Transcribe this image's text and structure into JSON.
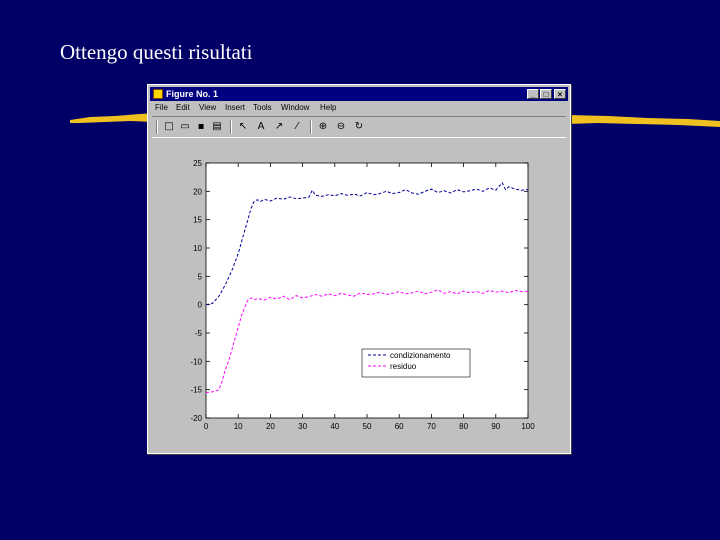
{
  "slide": {
    "title": "Ottengo questi risultati"
  },
  "window": {
    "title": "Figure No. 1",
    "buttons": {
      "minimize": "_",
      "maximize": "□",
      "close": "×"
    },
    "menu": [
      "File",
      "Edit",
      "View",
      "Insert",
      "Tools",
      "Window",
      "Help"
    ]
  },
  "toolbar": {
    "tools": [
      {
        "name": "new-file-icon",
        "glyph": "□"
      },
      {
        "name": "open-folder-icon",
        "glyph": "▭"
      },
      {
        "name": "save-icon",
        "glyph": "▪"
      },
      {
        "name": "print-icon",
        "glyph": "▤"
      },
      {
        "name": "select-arrow-icon",
        "glyph": "↖"
      },
      {
        "name": "text-tool-icon",
        "glyph": "A"
      },
      {
        "name": "arrow-tool-icon",
        "glyph": "↗"
      },
      {
        "name": "line-tool-icon",
        "glyph": "⁄"
      },
      {
        "name": "zoom-in-icon",
        "glyph": "⊕"
      },
      {
        "name": "zoom-out-icon",
        "glyph": "⊖"
      },
      {
        "name": "rotate-icon",
        "glyph": "↻"
      }
    ]
  },
  "colors": {
    "background": "#000066",
    "series1": "#000099",
    "series2": "#ff00ff",
    "brush": "#f0c020"
  },
  "chart_data": {
    "type": "line",
    "xlim": [
      0,
      100
    ],
    "ylim": [
      -20,
      25
    ],
    "xticks": [
      0,
      10,
      20,
      30,
      40,
      50,
      60,
      70,
      80,
      90,
      100
    ],
    "yticks": [
      -20,
      -15,
      -10,
      -5,
      0,
      5,
      10,
      15,
      20,
      25
    ],
    "xtick_labels": [
      "0",
      "10",
      "20",
      "30",
      "40",
      "50",
      "60",
      "70",
      "80",
      "90",
      "100"
    ],
    "ytick_labels": [
      "-20",
      "-15",
      "-10",
      "-5",
      "0",
      "5",
      "10",
      "15",
      "20",
      "25"
    ],
    "grid": false,
    "legend_placement": "lower-right",
    "series": [
      {
        "name": "condizionamento",
        "style": "dashed",
        "color": "#000099",
        "x": [
          0,
          2,
          4,
          6,
          8,
          10,
          11,
          12,
          13,
          14,
          15,
          16,
          17,
          18,
          20,
          22,
          24,
          26,
          28,
          30,
          32,
          33,
          34,
          36,
          38,
          40,
          42,
          44,
          46,
          48,
          50,
          52,
          54,
          56,
          58,
          60,
          62,
          64,
          66,
          68,
          70,
          72,
          74,
          76,
          78,
          80,
          82,
          84,
          86,
          88,
          90,
          92,
          93,
          94,
          96,
          98,
          100
        ],
        "y": [
          0,
          0.2,
          1.5,
          3.5,
          6,
          9,
          11,
          13,
          15,
          17,
          18.3,
          18.5,
          18.2,
          18.6,
          18.3,
          18.8,
          18.6,
          19.0,
          18.7,
          18.8,
          19.0,
          20.2,
          19.3,
          19.1,
          19.4,
          19.2,
          19.6,
          19.3,
          19.5,
          19.2,
          19.8,
          19.4,
          19.6,
          20.0,
          19.6,
          19.8,
          20.3,
          19.7,
          19.5,
          20.0,
          20.4,
          19.8,
          20.1,
          19.7,
          20.3,
          19.9,
          20.1,
          20.4,
          20.0,
          20.6,
          20.2,
          21.5,
          20.3,
          20.8,
          20.4,
          20.2,
          20.3
        ]
      },
      {
        "name": "residuo",
        "style": "dashed",
        "color": "#ff00ff",
        "x": [
          0,
          2,
          4,
          5,
          6,
          7,
          8,
          9,
          10,
          11,
          12,
          13,
          14,
          15,
          16,
          18,
          20,
          22,
          24,
          26,
          28,
          30,
          32,
          34,
          36,
          38,
          40,
          42,
          44,
          46,
          48,
          50,
          52,
          54,
          56,
          58,
          60,
          62,
          64,
          66,
          68,
          70,
          72,
          74,
          76,
          78,
          80,
          82,
          84,
          86,
          88,
          90,
          92,
          94,
          96,
          98,
          100
        ],
        "y": [
          -15.5,
          -15.4,
          -15.0,
          -13.5,
          -11.5,
          -10.0,
          -8.0,
          -6.0,
          -4.0,
          -2.0,
          -0.5,
          0.8,
          1.2,
          0.9,
          1.1,
          0.8,
          1.3,
          1.0,
          1.5,
          0.9,
          1.6,
          1.2,
          1.4,
          1.8,
          1.5,
          1.9,
          1.6,
          2.0,
          1.7,
          1.5,
          2.1,
          1.8,
          1.9,
          2.2,
          1.8,
          2.0,
          2.3,
          1.9,
          2.1,
          2.4,
          1.9,
          2.2,
          2.6,
          2.0,
          2.3,
          1.9,
          2.4,
          2.1,
          2.3,
          2.0,
          2.5,
          2.2,
          2.4,
          2.1,
          2.5,
          2.3,
          2.4
        ]
      }
    ]
  }
}
